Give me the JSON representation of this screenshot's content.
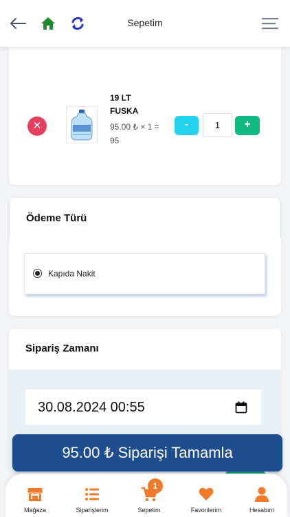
{
  "header": {
    "title": "Sepetim",
    "icons": [
      "back-arrow-icon",
      "home-icon",
      "refresh-icon",
      "menu-icon"
    ]
  },
  "cart": {
    "items": [
      {
        "name": "19 LT FUSKA",
        "price_line": "95.00 ₺ × 1 = 95",
        "quantity": "1",
        "minus_label": "-",
        "plus_label": "+",
        "remove_label": "✕"
      }
    ]
  },
  "payment": {
    "title": "Ödeme Türü",
    "options": [
      {
        "label": "Kapıda Nakit",
        "selected": true
      }
    ]
  },
  "order_time": {
    "title": "Sipariş Zamanı",
    "datetime": "30.08.2024 00:55"
  },
  "checkout": {
    "label": "95.00 ₺ Siparişi Tamamla"
  },
  "bottom_nav": {
    "items": [
      {
        "label": "Mağaza",
        "icon": "store-icon"
      },
      {
        "label": "Siparişlerim",
        "icon": "orders-list-icon"
      },
      {
        "label": "Sepetim",
        "icon": "cart-icon",
        "badge": "1"
      },
      {
        "label": "Favorilerim",
        "icon": "heart-icon"
      },
      {
        "label": "Hesabım",
        "icon": "user-icon"
      }
    ]
  },
  "colors": {
    "accent_orange": "#f07a2a",
    "checkout_blue": "#1e4d8f",
    "minus_cyan": "#22d3ee",
    "plus_green": "#10b981",
    "remove_red": "#e5405e",
    "home_green": "#1f8a2e",
    "refresh_blue": "#2437c9"
  }
}
